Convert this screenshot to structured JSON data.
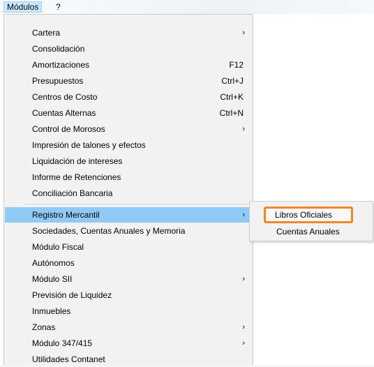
{
  "menubar": {
    "modulos": "Módulos",
    "help": "?"
  },
  "menu": {
    "items": [
      {
        "label": "Cartera",
        "shortcut": "",
        "submenu": true
      },
      {
        "label": "Consolidación",
        "shortcut": "",
        "submenu": false
      },
      {
        "label": "Amortizaciones",
        "shortcut": "F12",
        "submenu": false
      },
      {
        "label": "Presupuestos",
        "shortcut": "Ctrl+J",
        "submenu": false
      },
      {
        "label": "Centros de Costo",
        "shortcut": "Ctrl+K",
        "submenu": false
      },
      {
        "label": "Cuentas Alternas",
        "shortcut": "Ctrl+N",
        "submenu": false
      },
      {
        "label": "Control de Morosos",
        "shortcut": "",
        "submenu": true
      },
      {
        "label": "Impresión de talones y efectos",
        "shortcut": "",
        "submenu": false
      },
      {
        "label": "Liquidación de intereses",
        "shortcut": "",
        "submenu": false
      },
      {
        "label": "Informe de Retenciones",
        "shortcut": "",
        "submenu": false
      },
      {
        "label": "Conciliación Bancaria",
        "shortcut": "",
        "submenu": false
      },
      {
        "label": "Registro Mercantil",
        "shortcut": "",
        "submenu": true,
        "highlighted": true
      },
      {
        "label": "Sociedades, Cuentas Anuales y Memoria",
        "shortcut": "",
        "submenu": false
      },
      {
        "label": "Módulo Fiscal",
        "shortcut": "",
        "submenu": false
      },
      {
        "label": "Autónomos",
        "shortcut": "",
        "submenu": false
      },
      {
        "label": "Módulo SII",
        "shortcut": "",
        "submenu": true
      },
      {
        "label": "Previsión de Liquidez",
        "shortcut": "",
        "submenu": false
      },
      {
        "label": "Inmuebles",
        "shortcut": "",
        "submenu": false
      },
      {
        "label": "Zonas",
        "shortcut": "",
        "submenu": true
      },
      {
        "label": "Módulo 347/415",
        "shortcut": "",
        "submenu": true
      },
      {
        "label": "Utilidades Contanet",
        "shortcut": "",
        "submenu": false
      }
    ],
    "arrow_glyph": "›"
  },
  "submenu": {
    "items": [
      {
        "label": "Libros Oficiales",
        "callout": true
      },
      {
        "label": "Cuentas Anuales",
        "callout": false
      }
    ]
  },
  "colors": {
    "highlight": "#91c9f7",
    "menu_background": "#f2f2f2",
    "callout_border": "#f0862a",
    "menubar_selected": "#cce8ff"
  }
}
